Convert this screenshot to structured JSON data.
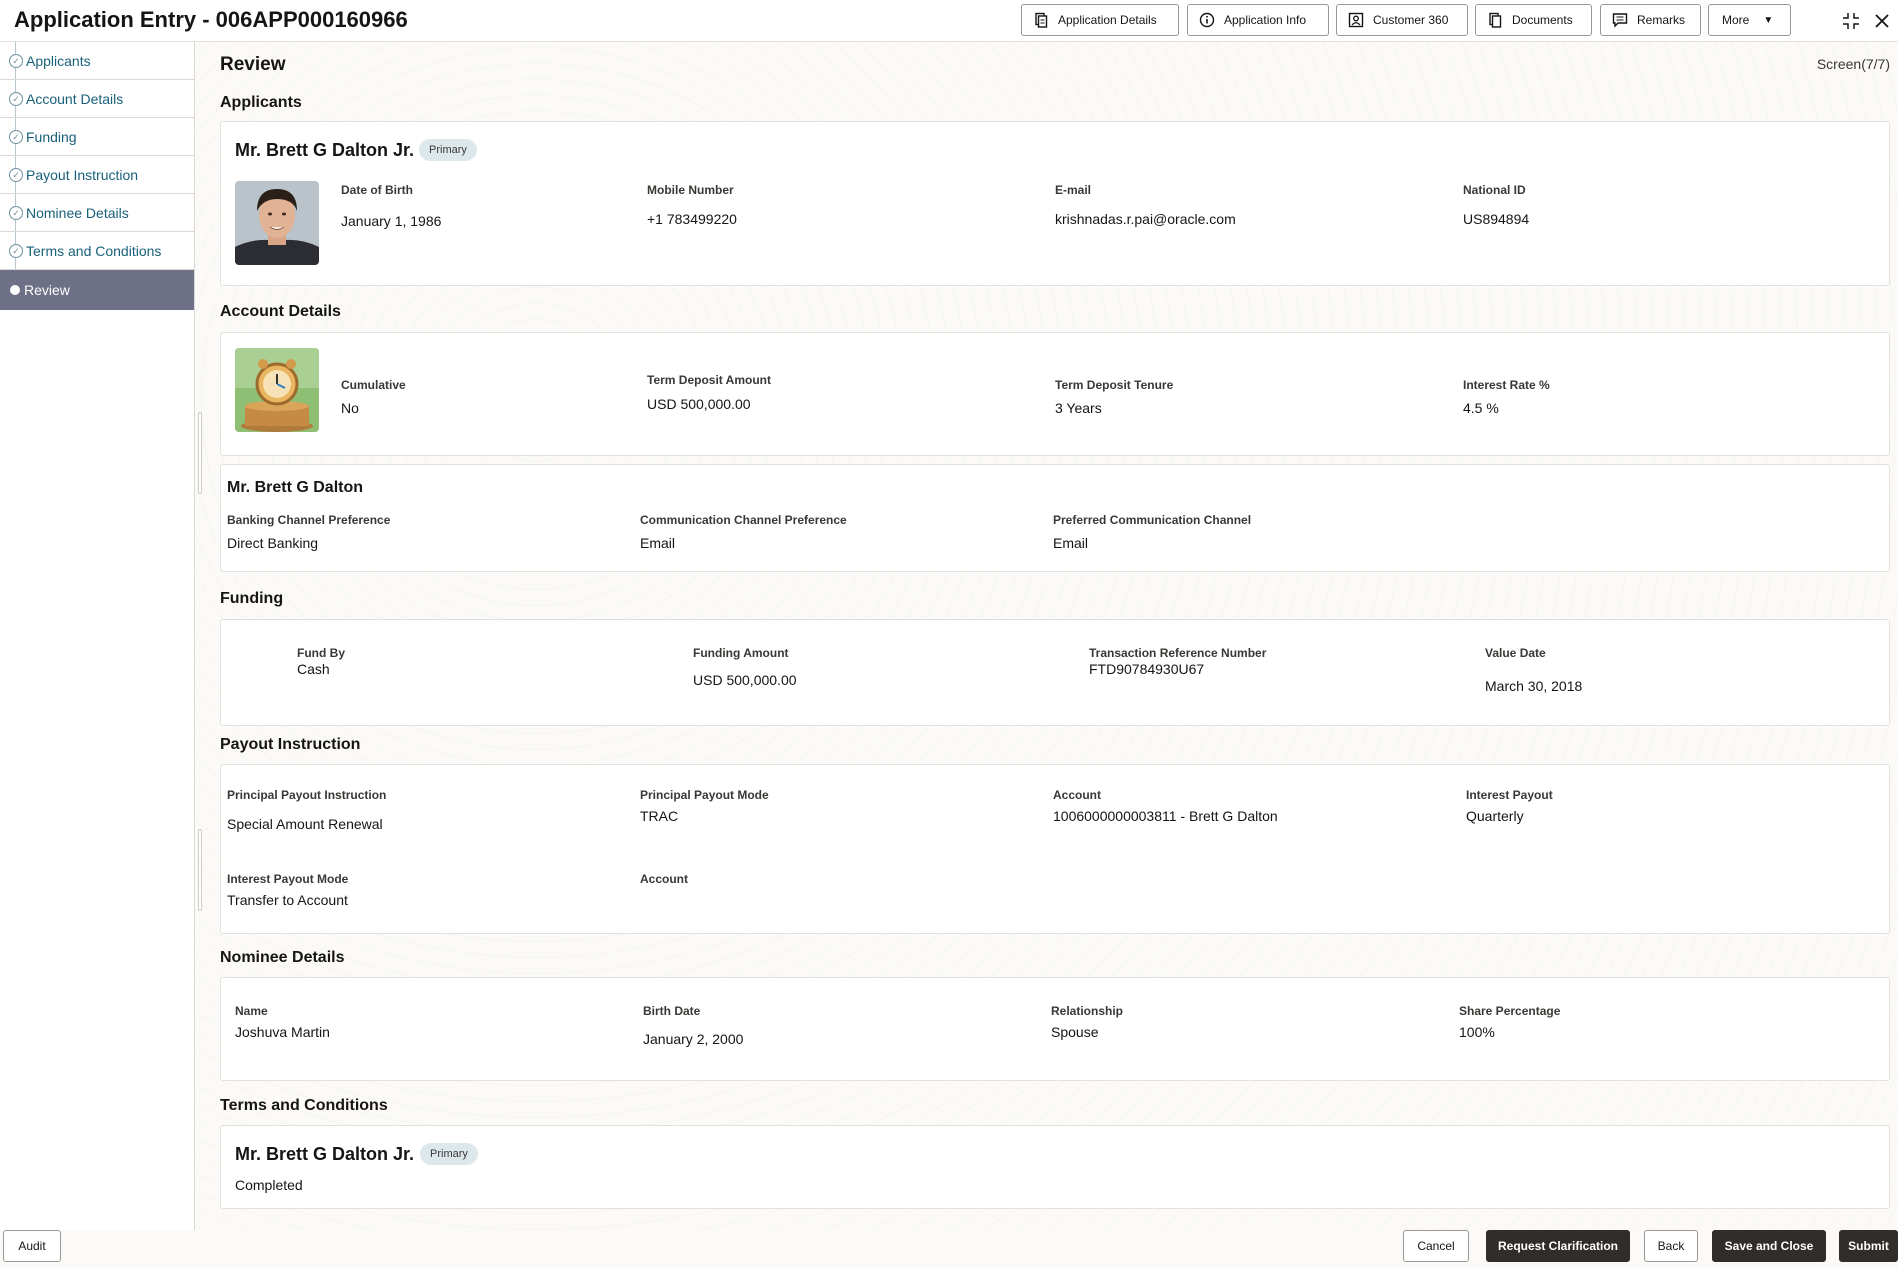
{
  "header": {
    "title": "Application Entry - 006APP000160966",
    "buttons": {
      "application_details": "Application Details",
      "application_info": "Application Info",
      "customer_360": "Customer 360",
      "documents": "Documents",
      "remarks": "Remarks",
      "more": "More"
    }
  },
  "sidebar": {
    "items": [
      {
        "label": "Applicants",
        "state": "completed"
      },
      {
        "label": "Account Details",
        "state": "completed"
      },
      {
        "label": "Funding",
        "state": "completed"
      },
      {
        "label": "Payout Instruction",
        "state": "completed"
      },
      {
        "label": "Nominee Details",
        "state": "completed"
      },
      {
        "label": "Terms and Conditions",
        "state": "completed"
      },
      {
        "label": "Review",
        "state": "active"
      }
    ]
  },
  "page": {
    "title": "Review",
    "screen": "Screen(7/7)"
  },
  "applicants": {
    "section_title": "Applicants",
    "name": "Mr. Brett G Dalton Jr.",
    "badge": "Primary",
    "fields": {
      "dob_label": "Date of Birth",
      "dob": "January 1, 1986",
      "mobile_label": "Mobile Number",
      "mobile": "+1 783499220",
      "email_label": "E-mail",
      "email": "krishnadas.r.pai@oracle.com",
      "nid_label": "National ID",
      "nid": "US894894"
    }
  },
  "account_details": {
    "section_title": "Account Details",
    "cumulative_label": "Cumulative",
    "cumulative": "No",
    "amount_label": "Term Deposit Amount",
    "amount": "USD 500,000.00",
    "tenure_label": "Term Deposit Tenure",
    "tenure": "3 Years",
    "rate_label": "Interest Rate %",
    "rate": "4.5 %",
    "holder": {
      "name": "Mr. Brett G Dalton",
      "banking_label": "Banking Channel Preference",
      "banking": "Direct Banking",
      "comm_label": "Communication Channel Preference",
      "comm": "Email",
      "pref_label": "Preferred Communication Channel",
      "pref": "Email"
    }
  },
  "funding": {
    "section_title": "Funding",
    "fund_by_label": "Fund By",
    "fund_by": "Cash",
    "amount_label": "Funding Amount",
    "amount": "USD 500,000.00",
    "txn_label": "Transaction Reference Number",
    "txn": "FTD90784930U67",
    "value_date_label": "Value Date",
    "value_date": "March 30, 2018"
  },
  "payout": {
    "section_title": "Payout Instruction",
    "ppi_label": "Principal Payout Instruction",
    "ppi": "Special Amount Renewal",
    "ppm_label": "Principal Payout Mode",
    "ppm": "TRAC",
    "account_label": "Account",
    "account": "1006000000003811 - Brett G Dalton",
    "ip_label": "Interest Payout",
    "ip": "Quarterly",
    "ipm_label": "Interest Payout Mode",
    "ipm": "Transfer to Account",
    "account2_label": "Account"
  },
  "nominee": {
    "section_title": "Nominee Details",
    "name_label": "Name",
    "name": "Joshuva Martin",
    "birth_label": "Birth Date",
    "birth": "January 2, 2000",
    "rel_label": "Relationship",
    "rel": "Spouse",
    "share_label": "Share Percentage",
    "share": "100%"
  },
  "terms": {
    "section_title": "Terms and Conditions",
    "name": "Mr. Brett G Dalton Jr.",
    "badge": "Primary",
    "status": "Completed"
  },
  "footer": {
    "audit": "Audit",
    "cancel": "Cancel",
    "request_clarification": "Request Clarification",
    "back": "Back",
    "save_and_close": "Save and Close",
    "submit": "Submit"
  }
}
